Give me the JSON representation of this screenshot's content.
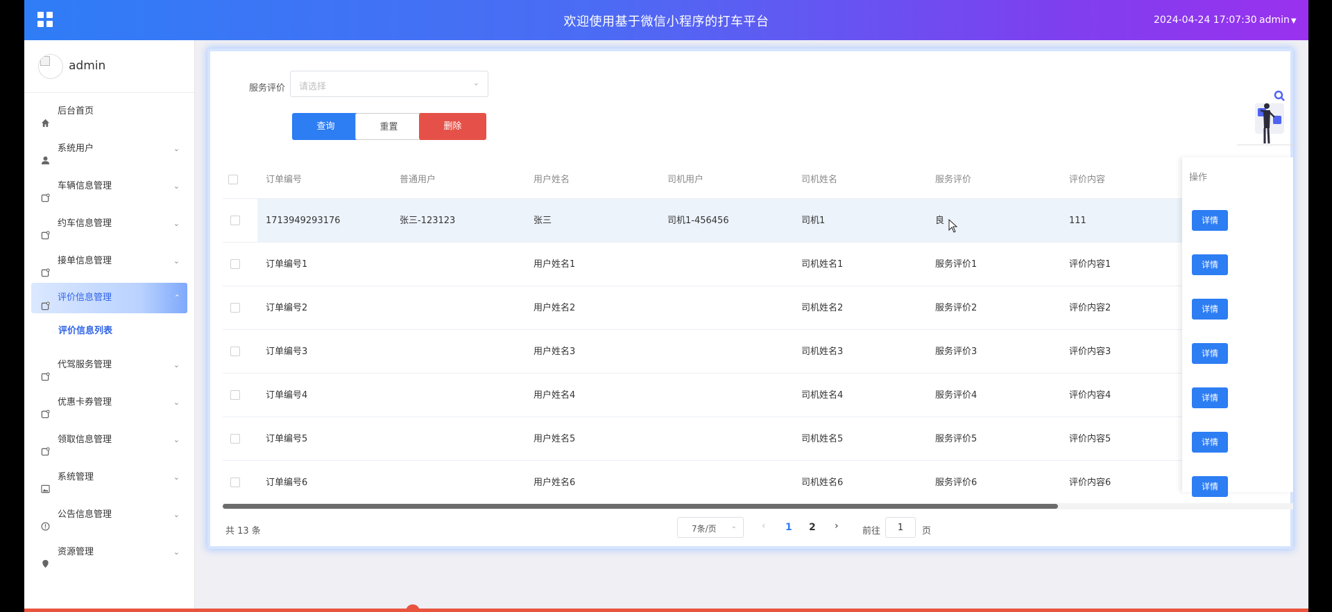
{
  "header": {
    "title": "欢迎使用基于微信小程序的打车平台",
    "datetime": "2024-04-24 17:07:30",
    "user": "admin"
  },
  "sidebar": {
    "username": "admin",
    "items": [
      {
        "label": "后台首页",
        "icon": "home-icon"
      },
      {
        "label": "系统用户",
        "icon": "user-icon"
      },
      {
        "label": "车辆信息管理",
        "icon": "doc-icon"
      },
      {
        "label": "约车信息管理",
        "icon": "doc-icon"
      },
      {
        "label": "接单信息管理",
        "icon": "doc-icon"
      },
      {
        "label": "评价信息管理",
        "icon": "doc-icon",
        "active": true
      },
      {
        "label": "代驾服务管理",
        "icon": "doc-icon"
      },
      {
        "label": "优惠卡券管理",
        "icon": "doc-icon"
      },
      {
        "label": "领取信息管理",
        "icon": "doc-icon"
      },
      {
        "label": "系统管理",
        "icon": "image-icon"
      },
      {
        "label": "公告信息管理",
        "icon": "info-icon"
      },
      {
        "label": "资源管理",
        "icon": "pin-icon"
      }
    ],
    "submenu": {
      "label": "评价信息列表"
    }
  },
  "filter": {
    "label": "服务评价",
    "placeholder": "请选择",
    "query_label": "查询",
    "reset_label": "重置",
    "delete_label": "删除"
  },
  "table": {
    "columns": [
      "订单编号",
      "普通用户",
      "用户姓名",
      "司机用户",
      "司机姓名",
      "服务评价",
      "评价内容"
    ],
    "ops_header": "操作",
    "detail_label": "详情",
    "rows": [
      [
        "1713949293176",
        "张三-123123",
        "张三",
        "司机1-456456",
        "司机1",
        "良",
        "111"
      ],
      [
        "订单编号1",
        "",
        "用户姓名1",
        "",
        "司机姓名1",
        "服务评价1",
        "评价内容1"
      ],
      [
        "订单编号2",
        "",
        "用户姓名2",
        "",
        "司机姓名2",
        "服务评价2",
        "评价内容2"
      ],
      [
        "订单编号3",
        "",
        "用户姓名3",
        "",
        "司机姓名3",
        "服务评价3",
        "评价内容3"
      ],
      [
        "订单编号4",
        "",
        "用户姓名4",
        "",
        "司机姓名4",
        "服务评价4",
        "评价内容4"
      ],
      [
        "订单编号5",
        "",
        "用户姓名5",
        "",
        "司机姓名5",
        "服务评价5",
        "评价内容5"
      ],
      [
        "订单编号6",
        "",
        "用户姓名6",
        "",
        "司机姓名6",
        "服务评价6",
        "评价内容6"
      ]
    ]
  },
  "pagination": {
    "total_text": "共 13 条",
    "page_size": "7条/页",
    "pages": [
      "1",
      "2"
    ],
    "current_page": "1",
    "goto_label": "前往",
    "goto_value": "1",
    "goto_suffix": "页"
  },
  "colors": {
    "primary": "#2d7df3",
    "danger": "#e55148",
    "header_gradient_start": "#2f7df6",
    "header_gradient_end": "#9a31ee"
  }
}
